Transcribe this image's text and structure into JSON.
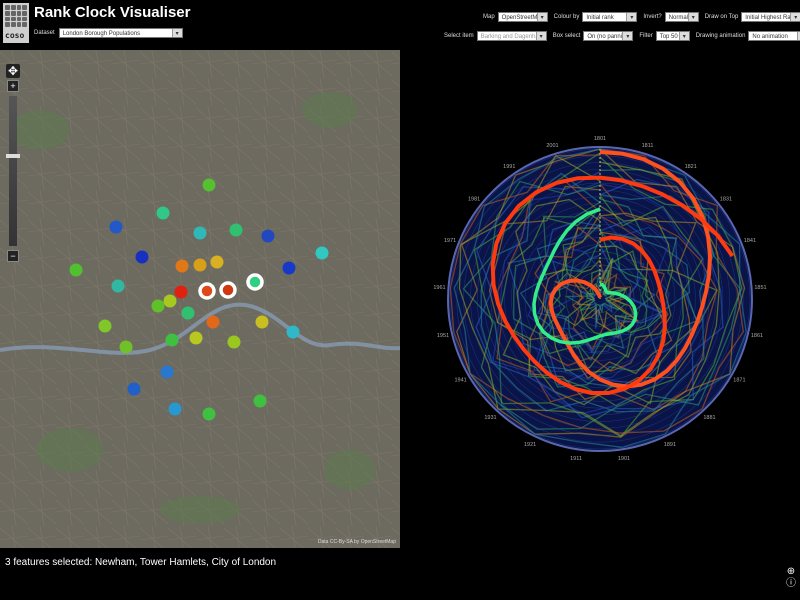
{
  "app": {
    "title": "Rank Clock Visualiser",
    "logo_text": "coso"
  },
  "dataset": {
    "label": "Dataset",
    "value": "London Borough Populations"
  },
  "controls_row1": [
    {
      "id": "map",
      "label": "Map",
      "value": "OpenStreetMap"
    },
    {
      "id": "colour-by",
      "label": "Colour by",
      "value": "Initial rank"
    },
    {
      "id": "invert",
      "label": "Invert?",
      "value": "Normal"
    },
    {
      "id": "draw-on-top",
      "label": "Draw on Top",
      "value": "Initial Highest Ranked"
    }
  ],
  "controls_row2": [
    {
      "id": "select-item",
      "label": "Select item",
      "value": "Barking and Dagenham"
    },
    {
      "id": "box-select",
      "label": "Box select",
      "value": "On (no panning)"
    },
    {
      "id": "filter",
      "label": "Filter",
      "value": "Top 50"
    },
    {
      "id": "drawing-animation",
      "label": "Drawing animation",
      "value": "No animation"
    }
  ],
  "map": {
    "attribution": "Data CC-By-SA by OpenStreetMap",
    "pan_icon": "pan-cross-icon",
    "zoom_in_label": "+",
    "zoom_out_label": "−"
  },
  "status": {
    "text": "3 features selected: Newham, Tower Hamlets, City of London"
  },
  "clock": {
    "year_labels": [
      "1801",
      "1811",
      "1821",
      "1831",
      "1841",
      "1851",
      "1861",
      "1871",
      "1881",
      "1891",
      "1901",
      "1911",
      "1921",
      "1931",
      "1941",
      "1951",
      "1961",
      "1971",
      "1981",
      "1991",
      "2001"
    ],
    "highlight_colors": [
      "#ff5020",
      "#ff3a10",
      "#33ee88"
    ]
  },
  "footer_icons": [
    "globe-icon",
    "info-icon"
  ]
}
